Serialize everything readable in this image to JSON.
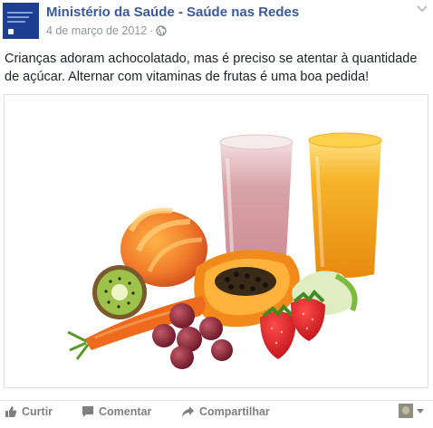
{
  "post": {
    "page_name": "Ministério da Saúde - Saúde nas Redes",
    "date": "4 de março de 2012",
    "separator": "·",
    "privacy_icon": "globe-icon",
    "options_icon": "chevron-down-icon",
    "text": "Crianças adoram achocolatado, mas é preciso se atentar à quantidade de açúcar. Alternar com vitaminas de frutas é uma boa pedida!"
  },
  "photo": {
    "subject": "smoothies-and-fruits"
  },
  "actions": {
    "like_label": "Curtir",
    "comment_label": "Comentar",
    "share_label": "Compartilhar"
  },
  "colors": {
    "link": "#3b5998",
    "meta": "#90949c",
    "action": "#7f7f7f"
  }
}
